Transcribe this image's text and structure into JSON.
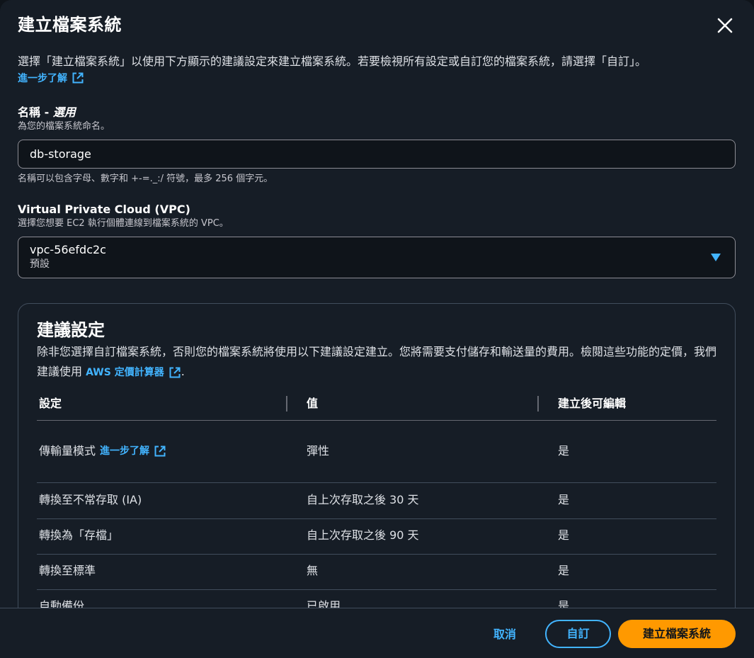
{
  "modal": {
    "title": "建立檔案系統",
    "description": "選擇「建立檔案系統」以使用下方顯示的建議設定來建立檔案系統。若要檢視所有設定或自訂您的檔案系統，請選擇「自訂」。",
    "learn_more": "進一步了解"
  },
  "name_field": {
    "label": "名稱 - ",
    "label_optional": "選用",
    "description": "為您的檔案系統命名。",
    "value": "db-storage",
    "constraint": "名稱可以包含字母、數字和 +-=._:/ 符號，最多 256 個字元。"
  },
  "vpc_field": {
    "label": "Virtual Private Cloud (VPC)",
    "description": "選擇您想要 EC2 執行個體連線到檔案系統的 VPC。",
    "selected_value": "vpc-56efdc2c",
    "selected_sub": "預設"
  },
  "recommended": {
    "title": "建議設定",
    "description_part1": "除非您選擇自訂檔案系統，否則您的檔案系統將使用以下建議設定建立。您將需要支付儲存和輸送量的費用。檢閱這些功能的定價，我們建議使用 ",
    "pricing_link": "AWS 定價計算器",
    "description_end": ".",
    "columns": [
      "設定",
      "值",
      "建立後可編輯"
    ],
    "rows": [
      {
        "setting": "傳輸量模式",
        "link": "進一步了解",
        "value": "彈性",
        "editable": "是"
      },
      {
        "setting": "轉換至不常存取 (IA)",
        "value": "自上次存取之後 30 天",
        "editable": "是"
      },
      {
        "setting": "轉換為「存檔」",
        "value": "自上次存取之後 90 天",
        "editable": "是"
      },
      {
        "setting": "轉換至標準",
        "value": "無",
        "editable": "是"
      },
      {
        "setting": "自動備份",
        "value": "已啟用",
        "editable": "是"
      }
    ]
  },
  "footer": {
    "cancel": "取消",
    "customize": "自訂",
    "create": "建立檔案系統"
  },
  "colors": {
    "link": "#42b4ff",
    "primary": "#ff9900",
    "background": "#161d26"
  },
  "icons": [
    "close-icon",
    "external-link-icon",
    "caret-down-icon"
  ]
}
